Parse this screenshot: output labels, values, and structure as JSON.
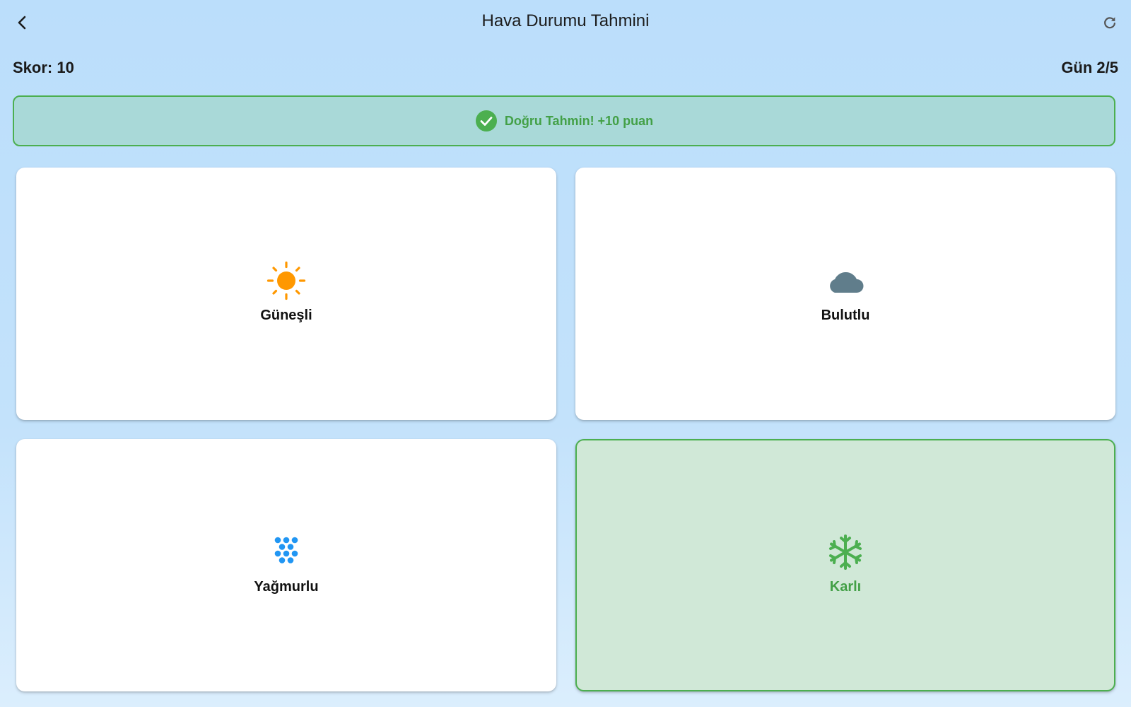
{
  "app_bar": {
    "title": "Hava Durumu Tahmini",
    "back_icon": "chevron-left-icon",
    "refresh_icon": "refresh-icon"
  },
  "status": {
    "score_label": "Skor: 10",
    "day_label": "Gün 2/5"
  },
  "feedback": {
    "message": "Doğru Tahmin! +10 puan",
    "icon": "check-circle-icon",
    "color": "#4caf50"
  },
  "options": [
    {
      "label": "Güneşli",
      "icon": "sun-icon",
      "color": "#ff9800",
      "selected": false
    },
    {
      "label": "Bulutlu",
      "icon": "cloud-icon",
      "color": "#607d8b",
      "selected": false
    },
    {
      "label": "Yağmurlu",
      "icon": "rain-icon",
      "color": "#2196f3",
      "selected": false
    },
    {
      "label": "Karlı",
      "icon": "snowflake-icon",
      "color": "#4caf50",
      "selected": true
    }
  ],
  "colors": {
    "background": "#bbdefb",
    "success": "#4caf50",
    "success_bg": "#d0e8d7"
  }
}
